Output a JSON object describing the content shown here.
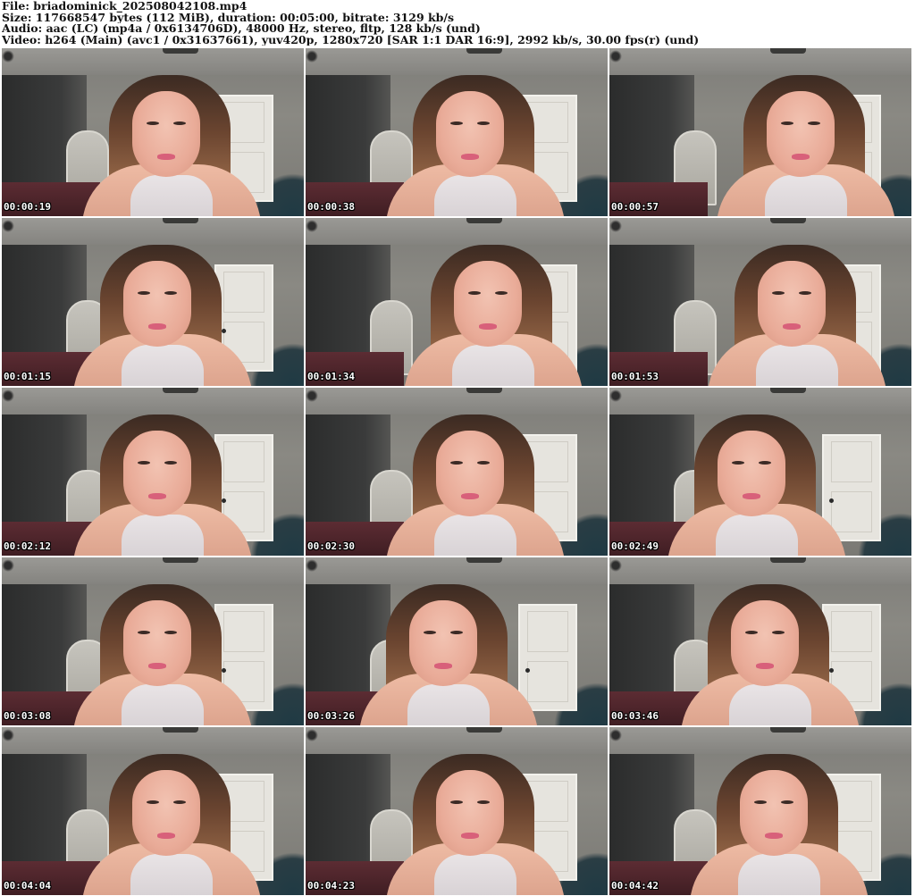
{
  "header": {
    "file": "File: briadominick_202508042108.mp4",
    "size": "Size: 117668547 bytes (112 MiB), duration: 00:05:00, bitrate: 3129 kb/s",
    "audio": "Audio: aac (LC) (mp4a / 0x6134706D), 48000 Hz, stereo, fltp, 128 kb/s (und)",
    "video": "Video: h264 (Main) (avc1 / 0x31637661), yuv420p, 1280x720 [SAR 1:1 DAR 16:9], 2992 kb/s, 30.00 fps(r) (und)"
  },
  "thumbnails": [
    {
      "timestamp": "00:00:19"
    },
    {
      "timestamp": "00:00:38"
    },
    {
      "timestamp": "00:00:57"
    },
    {
      "timestamp": "00:01:15"
    },
    {
      "timestamp": "00:01:34"
    },
    {
      "timestamp": "00:01:53"
    },
    {
      "timestamp": "00:02:12"
    },
    {
      "timestamp": "00:02:30"
    },
    {
      "timestamp": "00:02:49"
    },
    {
      "timestamp": "00:03:08"
    },
    {
      "timestamp": "00:03:26"
    },
    {
      "timestamp": "00:03:46"
    },
    {
      "timestamp": "00:04:04"
    },
    {
      "timestamp": "00:04:23"
    },
    {
      "timestamp": "00:04:42"
    }
  ],
  "colors": {
    "background": "#ffffff",
    "header_text": "#111111",
    "timestamp_text": "#ffffff",
    "timestamp_outline": "#000000"
  }
}
